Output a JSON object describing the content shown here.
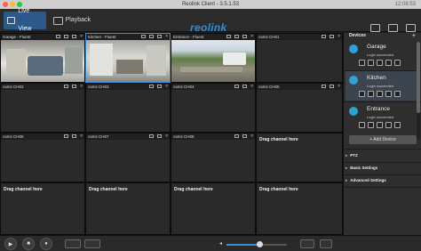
{
  "titlebar": {
    "title": "Reolink Client - 3.5.1.53",
    "time": "12:08:53"
  },
  "toolbar": {
    "live_view": "Live View",
    "playback": "Playback",
    "logo": "reolink"
  },
  "grid": {
    "cells": [
      {
        "name": "Garage - Fluent"
      },
      {
        "name": "Kitchen - Fluent"
      },
      {
        "name": "Entrance - Fluent"
      },
      {
        "name": "cams CH01"
      },
      {
        "name": "cams CH02"
      },
      {
        "name": "cams CH03"
      },
      {
        "name": "cams CH04"
      },
      {
        "name": "cams CH05"
      },
      {
        "name": "cams CH06"
      },
      {
        "name": "cams CH07"
      },
      {
        "name": "cams CH08"
      }
    ],
    "close_glyph": "×",
    "drag_text": "Drag channel here"
  },
  "panel": {
    "header": "Devices",
    "add_icon": "+",
    "devices": [
      {
        "name": "Garage",
        "status": "Login succeeded"
      },
      {
        "name": "Kitchen",
        "status": "Login succeeded"
      },
      {
        "name": "Entrance",
        "status": "Login succeeded"
      }
    ],
    "add_device": "+ Add Device",
    "sections": [
      "PTZ",
      "Basic Settings",
      "Advanced Settings"
    ],
    "arrow_glyph": "▸"
  },
  "bottom": {
    "volume_fraction": 0.55
  },
  "colors": {
    "accent": "#2f8fd6",
    "titlebar": "#cfcfcf",
    "panel": "#2e2e2e",
    "grid_bg": "#101010"
  }
}
